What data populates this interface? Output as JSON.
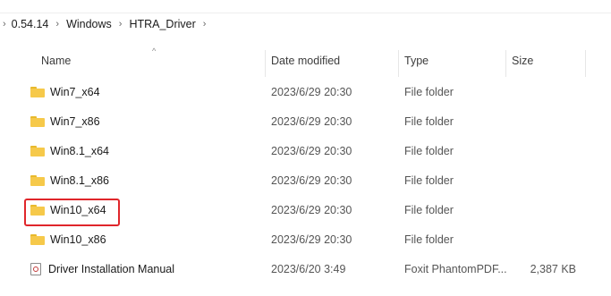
{
  "breadcrumb": {
    "leading_sep": "›",
    "items": [
      {
        "label": "0.54.14"
      },
      {
        "label": "Windows"
      },
      {
        "label": "HTRA_Driver"
      }
    ],
    "trailing_sep": "›"
  },
  "columns": {
    "name": "Name",
    "date": "Date modified",
    "type": "Type",
    "size": "Size",
    "sort_indicator": "^"
  },
  "files": [
    {
      "name": "Win7_x64",
      "date": "2023/6/29 20:30",
      "type": "File folder",
      "size": "",
      "icon": "folder-icon"
    },
    {
      "name": "Win7_x86",
      "date": "2023/6/29 20:30",
      "type": "File folder",
      "size": "",
      "icon": "folder-icon"
    },
    {
      "name": "Win8.1_x64",
      "date": "2023/6/29 20:30",
      "type": "File folder",
      "size": "",
      "icon": "folder-icon"
    },
    {
      "name": "Win8.1_x86",
      "date": "2023/6/29 20:30",
      "type": "File folder",
      "size": "",
      "icon": "folder-icon"
    },
    {
      "name": "Win10_x64",
      "date": "2023/6/29 20:30",
      "type": "File folder",
      "size": "",
      "icon": "folder-icon",
      "highlighted": true
    },
    {
      "name": "Win10_x86",
      "date": "2023/6/29 20:30",
      "type": "File folder",
      "size": "",
      "icon": "folder-icon"
    },
    {
      "name": "Driver Installation Manual",
      "date": "2023/6/20 3:49",
      "type": "Foxit PhantomPDF...",
      "size": "2,387 KB",
      "icon": "pdf-icon"
    }
  ],
  "colors": {
    "folder": "#f6c94a",
    "highlight_border": "#e0262b"
  }
}
